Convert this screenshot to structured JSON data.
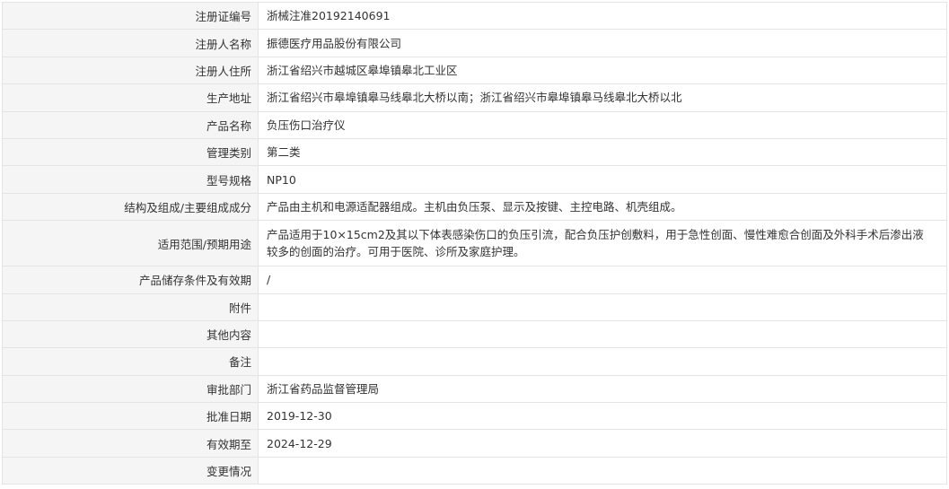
{
  "rows": [
    {
      "label": "注册证编号",
      "value": "浙械注准20192140691"
    },
    {
      "label": "注册人名称",
      "value": "振德医疗用品股份有限公司"
    },
    {
      "label": "注册人住所",
      "value": "浙江省绍兴市越城区皋埠镇皋北工业区"
    },
    {
      "label": "生产地址",
      "value": "浙江省绍兴市皋埠镇皋马线皋北大桥以南；浙江省绍兴市皋埠镇皋马线皋北大桥以北"
    },
    {
      "label": "产品名称",
      "value": "负压伤口治疗仪"
    },
    {
      "label": "管理类别",
      "value": "第二类"
    },
    {
      "label": "型号规格",
      "value": "NP10"
    },
    {
      "label": "结构及组成/主要组成成分",
      "value": "产品由主机和电源适配器组成。主机由负压泵、显示及按键、主控电路、机壳组成。"
    },
    {
      "label": "适用范围/预期用途",
      "value_line1": "产品适用于10×15cm2及其以下体表感染伤口的负压引流，配合负压护创敷料，用于急性创面、慢性难愈合创面及外科手术后渗出液",
      "value_line2": "较多的创面的治疗。可用于医院、诊所及家庭护理。"
    },
    {
      "label": "产品储存条件及有效期",
      "value": "/"
    },
    {
      "label": "附件",
      "value": ""
    },
    {
      "label": "其他内容",
      "value": ""
    },
    {
      "label": "备注",
      "value": ""
    },
    {
      "label": "审批部门",
      "value": "浙江省药品监督管理局"
    },
    {
      "label": "批准日期",
      "value": "2019-12-30"
    },
    {
      "label": "有效期至",
      "value": "2024-12-29"
    },
    {
      "label": "变更情况",
      "value": ""
    }
  ]
}
